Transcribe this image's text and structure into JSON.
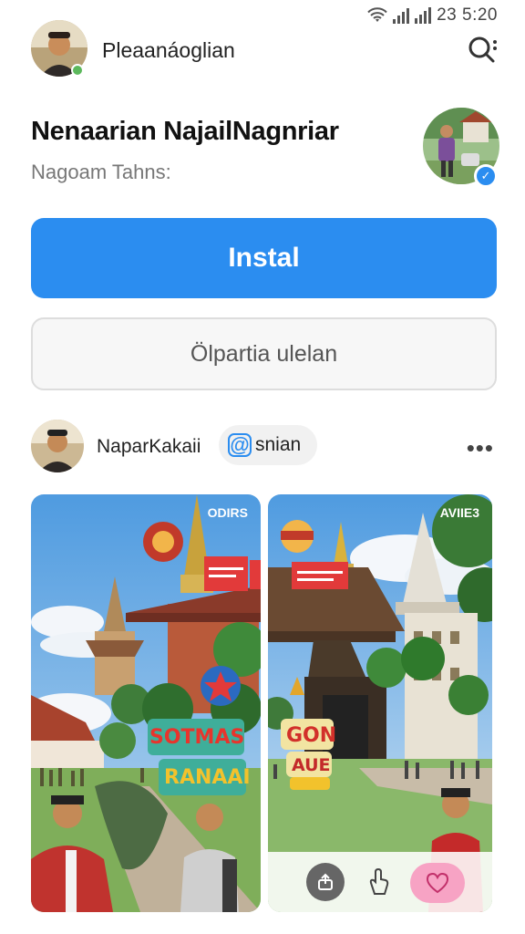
{
  "status_bar": {
    "time": "23 5:20"
  },
  "header": {
    "title": "Pleaanáoglian",
    "avatar": "user-avatar",
    "search_icon": "search-icon"
  },
  "profile": {
    "name": "Nenaarian NajailNagnriar",
    "subtitle": "Nagoam Tahns:",
    "avatar": "profile-avatar",
    "verified": true
  },
  "actions": {
    "primary_label": "Instal",
    "secondary_label": "Ölpartia ulelan"
  },
  "post": {
    "author": "NaparKakaii",
    "handle_symbol": "@",
    "handle_text": "snian",
    "more_label": "•••"
  },
  "cards": [
    {
      "tag": "ODIRS",
      "overlay_line1": "SOTMAS",
      "overlay_line2": "RANAAI"
    },
    {
      "tag": "AVIIE3",
      "overlay_line1": "GON",
      "overlay_line2": "AUE"
    }
  ],
  "colors": {
    "accent": "#2b8df0",
    "like": "#f7a3c4",
    "verified": "#2b8df0",
    "online": "#5cb85c"
  }
}
